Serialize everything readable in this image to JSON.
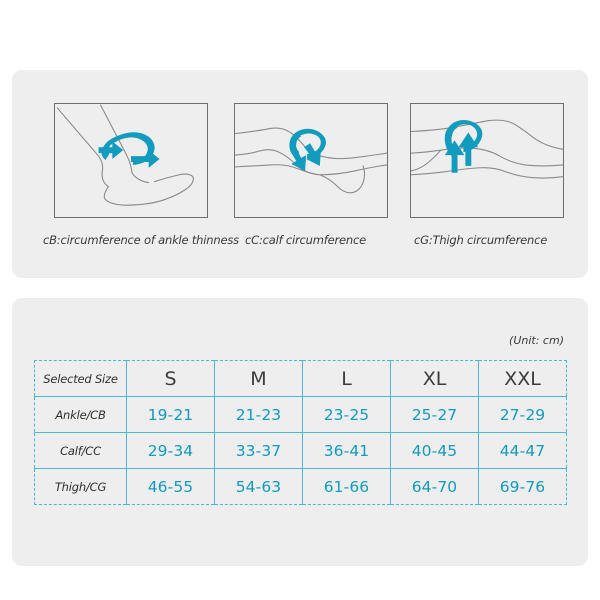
{
  "illustrations": {
    "panels": [
      {
        "id": "ankle",
        "code": "cB",
        "caption": "cB:circumference of ankle thinness",
        "arrow_color": "#119bbd",
        "outline_color": "#8a8a8a"
      },
      {
        "id": "calf",
        "code": "cC",
        "caption": "cC:calf circumference",
        "arrow_color": "#119bbd",
        "outline_color": "#8a8a8a"
      },
      {
        "id": "thigh",
        "code": "cG",
        "caption": "cG:Thigh circumference",
        "arrow_color": "#119bbd",
        "outline_color": "#8a8a8a"
      }
    ]
  },
  "size_table": {
    "unit_note": "(Unit: cm)",
    "corner_label": "Selected Size",
    "sizes": [
      "S",
      "M",
      "L",
      "XL",
      "XXL"
    ],
    "rows": [
      {
        "label": "Ankle/CB",
        "values": [
          "19-21",
          "21-23",
          "23-25",
          "25-27",
          "27-29"
        ]
      },
      {
        "label": "Calf/CC",
        "values": [
          "29-34",
          "33-37",
          "36-41",
          "40-45",
          "44-47"
        ]
      },
      {
        "label": "Thigh/CG",
        "values": [
          "46-55",
          "54-63",
          "61-66",
          "64-70",
          "69-76"
        ]
      }
    ]
  },
  "colors": {
    "page_background": "#ffffff",
    "card_background": "#eeeeee",
    "table_border": "#4bb8d6",
    "measure_text": "#119bbd",
    "heading_text": "#3d3d3d",
    "panel_border": "#6e6e6e"
  }
}
